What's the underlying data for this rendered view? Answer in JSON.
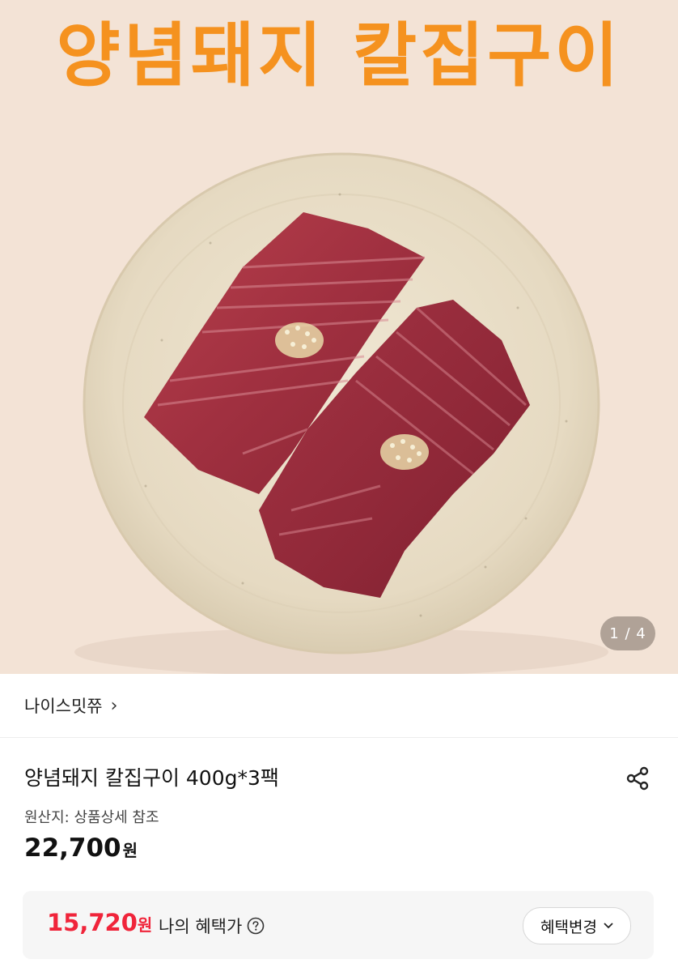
{
  "hero": {
    "title": "양념돼지 칼집구이",
    "page_indicator": "1 / 4",
    "image": "marinated-pork-on-plate"
  },
  "seller": {
    "name": "나이스밋쮸",
    "chevron": "›"
  },
  "product": {
    "title": "양념돼지 칼집구이 400g*3팩",
    "origin": "원산지: 상품상세 참조",
    "price": "22,700",
    "price_unit": "원"
  },
  "benefit": {
    "price": "15,720",
    "price_unit": "원",
    "label": "나의 혜택가",
    "change_button": "혜택변경"
  },
  "icons": {
    "share": "share-icon",
    "help": "question-circle-icon",
    "dropdown": "chevron-down-icon"
  },
  "colors": {
    "hero_bg": "#f3e3d6",
    "title_orange": "#f5921f",
    "benefit_red": "#f0243a"
  }
}
